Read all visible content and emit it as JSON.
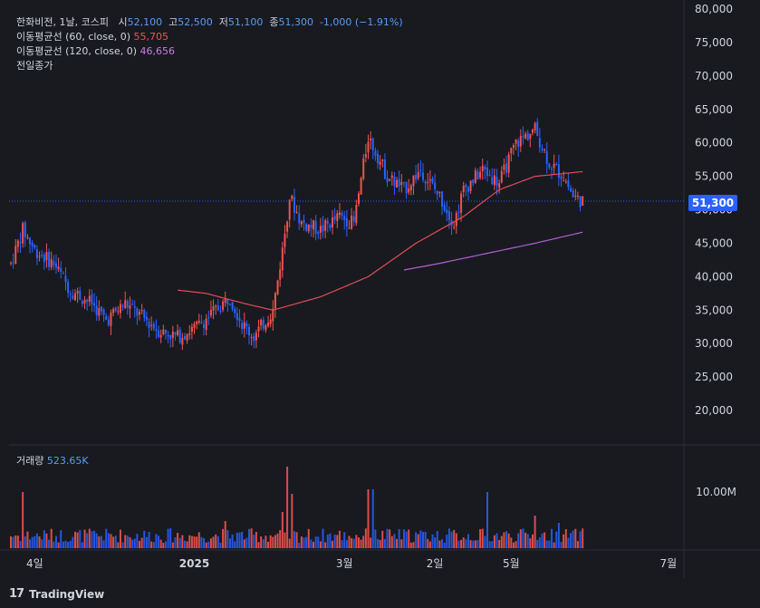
{
  "header": {
    "symbol": "한화비전, 1날, 코스피",
    "open_label": "시",
    "open": "52,100",
    "high_label": "고",
    "high": "52,500",
    "low_label": "저",
    "low": "51,100",
    "close_label": "종",
    "close": "51,300",
    "change": "-1,000 (−1.91%)"
  },
  "indicators": {
    "ma60_label": "이동평균선 (60, close, 0)",
    "ma60_value": "55,705",
    "ma120_label": "이동평균선 (120, close, 0)",
    "ma120_value": "46,656",
    "prev_close_label": "전일종가"
  },
  "volume": {
    "label": "거래량",
    "value": "523.65K"
  },
  "last_price_tag": "51,300",
  "footer": {
    "brand": "TradingView"
  },
  "colors": {
    "up": "#ef5350",
    "down": "#2962ff",
    "ma60": "#e34c55",
    "ma120": "#b45fd1",
    "accent": "#5b9cf6"
  },
  "chart_data": {
    "type": "candlestick",
    "y_ticks": [
      "80,000",
      "75,000",
      "70,000",
      "65,000",
      "60,000",
      "55,000",
      "50,000",
      "45,000",
      "40,000",
      "35,000",
      "30,000",
      "25,000",
      "20,000"
    ],
    "ylim": [
      15000,
      80000
    ],
    "x_ticks": [
      "4일",
      "2025",
      "3월",
      "2일",
      "5월",
      "7월"
    ],
    "volume_tick": "10.00M",
    "price_keyframes": [
      [
        0,
        42000
      ],
      [
        5,
        47000
      ],
      [
        10,
        44000
      ],
      [
        18,
        42000
      ],
      [
        25,
        38000
      ],
      [
        34,
        36000
      ],
      [
        40,
        33500
      ],
      [
        48,
        36000
      ],
      [
        55,
        34000
      ],
      [
        62,
        32000
      ],
      [
        70,
        31000
      ],
      [
        78,
        32500
      ],
      [
        86,
        35000
      ],
      [
        92,
        37000
      ],
      [
        97,
        33000
      ],
      [
        102,
        31000
      ],
      [
        110,
        35000
      ],
      [
        114,
        44000
      ],
      [
        117,
        52000
      ],
      [
        122,
        48000
      ],
      [
        130,
        47000
      ],
      [
        138,
        49000
      ],
      [
        144,
        48000
      ],
      [
        150,
        61000
      ],
      [
        158,
        55000
      ],
      [
        165,
        53000
      ],
      [
        172,
        56000
      ],
      [
        180,
        52000
      ],
      [
        186,
        48000
      ],
      [
        190,
        53000
      ],
      [
        198,
        56000
      ],
      [
        205,
        54000
      ],
      [
        212,
        60000
      ],
      [
        220,
        62000
      ],
      [
        226,
        57000
      ],
      [
        232,
        55000
      ],
      [
        236,
        52000
      ],
      [
        240,
        51300
      ]
    ],
    "ma60_keyframes": [
      [
        70,
        38000
      ],
      [
        82,
        37500
      ],
      [
        98,
        36000
      ],
      [
        110,
        35000
      ],
      [
        130,
        37000
      ],
      [
        150,
        40000
      ],
      [
        170,
        45000
      ],
      [
        190,
        49000
      ],
      [
        205,
        53000
      ],
      [
        220,
        55000
      ],
      [
        240,
        55705
      ]
    ],
    "ma120_keyframes": [
      [
        165,
        41000
      ],
      [
        180,
        42000
      ],
      [
        200,
        43500
      ],
      [
        220,
        45000
      ],
      [
        240,
        46656
      ]
    ]
  }
}
